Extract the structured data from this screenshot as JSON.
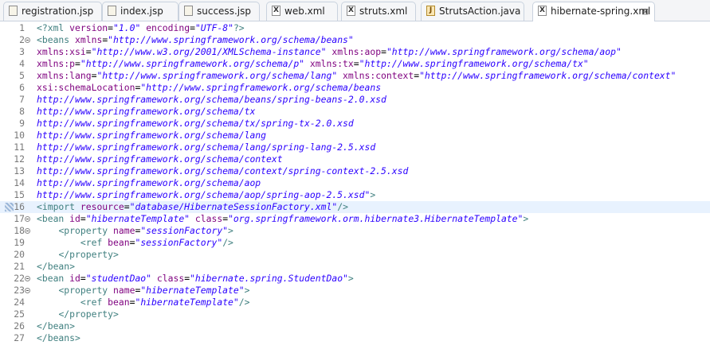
{
  "tabs": [
    {
      "label": "registration.jsp",
      "icon": "jsp-file-icon",
      "active": false
    },
    {
      "label": "index.jsp",
      "icon": "jsp-file-icon",
      "active": false
    },
    {
      "label": "success.jsp",
      "icon": "jsp-file-icon",
      "active": false
    },
    {
      "label": "web.xml",
      "icon": "xml-file-icon",
      "active": false
    },
    {
      "label": "struts.xml",
      "icon": "xml-file-icon",
      "active": false
    },
    {
      "label": "StrutsAction.java",
      "icon": "java-file-icon",
      "active": false
    },
    {
      "label": "hibernate-spring.xml",
      "icon": "xml-file-icon",
      "active": true
    }
  ],
  "close_glyph": "⊠",
  "editor": {
    "highlight_color": "#e8f2fe",
    "lines": [
      {
        "n": "1",
        "fold": false,
        "marker": false,
        "hl": false,
        "segs": [
          [
            "tg",
            "<?xml "
          ],
          [
            "at",
            "version"
          ],
          [
            "tx",
            "="
          ],
          [
            "vl",
            "\"1.0\""
          ],
          [
            "tx",
            " "
          ],
          [
            "at",
            "encoding"
          ],
          [
            "tx",
            "="
          ],
          [
            "vl",
            "\"UTF-8\""
          ],
          [
            "tg",
            "?>"
          ]
        ]
      },
      {
        "n": "2",
        "fold": true,
        "marker": false,
        "hl": false,
        "segs": [
          [
            "tg",
            "<beans "
          ],
          [
            "at",
            "xmlns"
          ],
          [
            "tx",
            "="
          ],
          [
            "vl",
            "\"http://www.springframework.org/schema/beans\""
          ]
        ]
      },
      {
        "n": "3",
        "fold": false,
        "marker": false,
        "hl": false,
        "segs": [
          [
            "at",
            "xmlns:xsi"
          ],
          [
            "tx",
            "="
          ],
          [
            "vl",
            "\"http://www.w3.org/2001/XMLSchema-instance\""
          ],
          [
            "tx",
            " "
          ],
          [
            "at",
            "xmlns:aop"
          ],
          [
            "tx",
            "="
          ],
          [
            "vl",
            "\"http://www.springframework.org/schema/aop\""
          ]
        ]
      },
      {
        "n": "4",
        "fold": false,
        "marker": false,
        "hl": false,
        "segs": [
          [
            "at",
            "xmlns:p"
          ],
          [
            "tx",
            "="
          ],
          [
            "vl",
            "\"http://www.springframework.org/schema/p\""
          ],
          [
            "tx",
            " "
          ],
          [
            "at",
            "xmlns:tx"
          ],
          [
            "tx",
            "="
          ],
          [
            "vl",
            "\"http://www.springframework.org/schema/tx\""
          ]
        ]
      },
      {
        "n": "5",
        "fold": false,
        "marker": false,
        "hl": false,
        "segs": [
          [
            "at",
            "xmlns:lang"
          ],
          [
            "tx",
            "="
          ],
          [
            "vl",
            "\"http://www.springframework.org/schema/lang\""
          ],
          [
            "tx",
            " "
          ],
          [
            "at",
            "xmlns:context"
          ],
          [
            "tx",
            "="
          ],
          [
            "vl",
            "\"http://www.springframework.org/schema/context\""
          ]
        ]
      },
      {
        "n": "6",
        "fold": false,
        "marker": false,
        "hl": false,
        "segs": [
          [
            "at",
            "xsi:schemaLocation"
          ],
          [
            "tx",
            "="
          ],
          [
            "vl",
            "\"http://www.springframework.org/schema/beans"
          ]
        ]
      },
      {
        "n": "7",
        "fold": false,
        "marker": false,
        "hl": false,
        "segs": [
          [
            "vl",
            "http://www.springframework.org/schema/beans/spring-beans-2.0.xsd"
          ]
        ]
      },
      {
        "n": "8",
        "fold": false,
        "marker": false,
        "hl": false,
        "segs": [
          [
            "vl",
            "http://www.springframework.org/schema/tx"
          ]
        ]
      },
      {
        "n": "9",
        "fold": false,
        "marker": false,
        "hl": false,
        "segs": [
          [
            "vl",
            "http://www.springframework.org/schema/tx/spring-tx-2.0.xsd"
          ]
        ]
      },
      {
        "n": "10",
        "fold": false,
        "marker": false,
        "hl": false,
        "segs": [
          [
            "vl",
            "http://www.springframework.org/schema/lang"
          ]
        ]
      },
      {
        "n": "11",
        "fold": false,
        "marker": false,
        "hl": false,
        "segs": [
          [
            "vl",
            "http://www.springframework.org/schema/lang/spring-lang-2.5.xsd"
          ]
        ]
      },
      {
        "n": "12",
        "fold": false,
        "marker": false,
        "hl": false,
        "segs": [
          [
            "vl",
            "http://www.springframework.org/schema/context"
          ]
        ]
      },
      {
        "n": "13",
        "fold": false,
        "marker": false,
        "hl": false,
        "segs": [
          [
            "vl",
            "http://www.springframework.org/schema/context/spring-context-2.5.xsd"
          ]
        ]
      },
      {
        "n": "14",
        "fold": false,
        "marker": false,
        "hl": false,
        "segs": [
          [
            "vl",
            "http://www.springframework.org/schema/aop"
          ]
        ]
      },
      {
        "n": "15",
        "fold": false,
        "marker": false,
        "hl": false,
        "segs": [
          [
            "vl",
            "http://www.springframework.org/schema/aop/spring-aop-2.5.xsd\""
          ],
          [
            "tg",
            ">"
          ]
        ]
      },
      {
        "n": "16",
        "fold": false,
        "marker": true,
        "hl": true,
        "segs": [
          [
            "tg",
            "<import "
          ],
          [
            "at",
            "resource"
          ],
          [
            "tx",
            "="
          ],
          [
            "vl",
            "\"database/HibernateSessionFactory.xml\""
          ],
          [
            "tg",
            "/>"
          ]
        ]
      },
      {
        "n": "17",
        "fold": true,
        "marker": false,
        "hl": false,
        "segs": [
          [
            "tg",
            "<bean "
          ],
          [
            "at",
            "id"
          ],
          [
            "tx",
            "="
          ],
          [
            "vl",
            "\"hibernateTemplate\""
          ],
          [
            "tx",
            " "
          ],
          [
            "at",
            "class"
          ],
          [
            "tx",
            "="
          ],
          [
            "vl",
            "\"org.springframework.orm.hibernate3.HibernateTemplate\""
          ],
          [
            "tg",
            ">"
          ]
        ]
      },
      {
        "n": "18",
        "fold": true,
        "marker": false,
        "hl": false,
        "segs": [
          [
            "tx",
            "    "
          ],
          [
            "tg",
            "<property "
          ],
          [
            "at",
            "name"
          ],
          [
            "tx",
            "="
          ],
          [
            "vl",
            "\"sessionFactory\""
          ],
          [
            "tg",
            ">"
          ]
        ]
      },
      {
        "n": "19",
        "fold": false,
        "marker": false,
        "hl": false,
        "segs": [
          [
            "tx",
            "        "
          ],
          [
            "tg",
            "<ref "
          ],
          [
            "at",
            "bean"
          ],
          [
            "tx",
            "="
          ],
          [
            "vl",
            "\"sessionFactory\""
          ],
          [
            "tg",
            "/>"
          ]
        ]
      },
      {
        "n": "20",
        "fold": false,
        "marker": false,
        "hl": false,
        "segs": [
          [
            "tx",
            "    "
          ],
          [
            "tg",
            "</property>"
          ]
        ]
      },
      {
        "n": "21",
        "fold": false,
        "marker": false,
        "hl": false,
        "segs": [
          [
            "tg",
            "</bean>"
          ]
        ]
      },
      {
        "n": "22",
        "fold": true,
        "marker": false,
        "hl": false,
        "segs": [
          [
            "tg",
            "<bean "
          ],
          [
            "at",
            "id"
          ],
          [
            "tx",
            "="
          ],
          [
            "vl",
            "\"studentDao\""
          ],
          [
            "tx",
            " "
          ],
          [
            "at",
            "class"
          ],
          [
            "tx",
            "="
          ],
          [
            "vl",
            "\"hibernate.spring.StudentDao\""
          ],
          [
            "tg",
            ">"
          ]
        ]
      },
      {
        "n": "23",
        "fold": true,
        "marker": false,
        "hl": false,
        "segs": [
          [
            "tx",
            "    "
          ],
          [
            "tg",
            "<property "
          ],
          [
            "at",
            "name"
          ],
          [
            "tx",
            "="
          ],
          [
            "vl",
            "\"hibernateTemplate\""
          ],
          [
            "tg",
            ">"
          ]
        ]
      },
      {
        "n": "24",
        "fold": false,
        "marker": false,
        "hl": false,
        "segs": [
          [
            "tx",
            "        "
          ],
          [
            "tg",
            "<ref "
          ],
          [
            "at",
            "bean"
          ],
          [
            "tx",
            "="
          ],
          [
            "vl",
            "\"hibernateTemplate\""
          ],
          [
            "tg",
            "/>"
          ]
        ]
      },
      {
        "n": "25",
        "fold": false,
        "marker": false,
        "hl": false,
        "segs": [
          [
            "tx",
            "    "
          ],
          [
            "tg",
            "</property>"
          ]
        ]
      },
      {
        "n": "26",
        "fold": false,
        "marker": false,
        "hl": false,
        "segs": [
          [
            "tg",
            "</bean>"
          ]
        ]
      },
      {
        "n": "27",
        "fold": false,
        "marker": false,
        "hl": false,
        "segs": [
          [
            "tg",
            "</beans>"
          ]
        ]
      }
    ]
  }
}
